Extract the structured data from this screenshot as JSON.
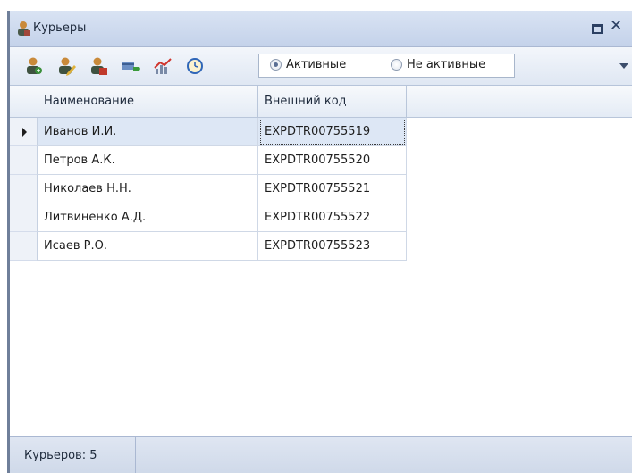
{
  "window": {
    "title": "Курьеры",
    "icon": "courier-icon"
  },
  "toolbar": {
    "buttons": [
      {
        "icon": "courier-add-icon"
      },
      {
        "icon": "courier-edit-icon"
      },
      {
        "icon": "courier-delete-icon"
      },
      {
        "icon": "courier-transfer-icon"
      },
      {
        "icon": "chart-icon"
      },
      {
        "icon": "clock-icon"
      }
    ],
    "filter": {
      "active_label": "Активные",
      "inactive_label": "Не активные",
      "selected": "active"
    }
  },
  "grid": {
    "columns": [
      "Наименование",
      "Внешний код"
    ],
    "rows": [
      {
        "name": "Иванов И.И.",
        "code": "EXPDTR00755519",
        "selected": true
      },
      {
        "name": "Петров А.К.",
        "code": "EXPDTR00755520"
      },
      {
        "name": "Николаев Н.Н.",
        "code": "EXPDTR00755521"
      },
      {
        "name": "Литвиненко А.Д.",
        "code": "EXPDTR00755522"
      },
      {
        "name": "Исаев Р.О.",
        "code": "EXPDTR00755523"
      }
    ]
  },
  "status": {
    "count_text": "Курьеров: 5"
  },
  "colors": {
    "title_bar": "#c4d2ea",
    "selection": "#dde7f5",
    "grid_line": "#cfd8e6"
  }
}
